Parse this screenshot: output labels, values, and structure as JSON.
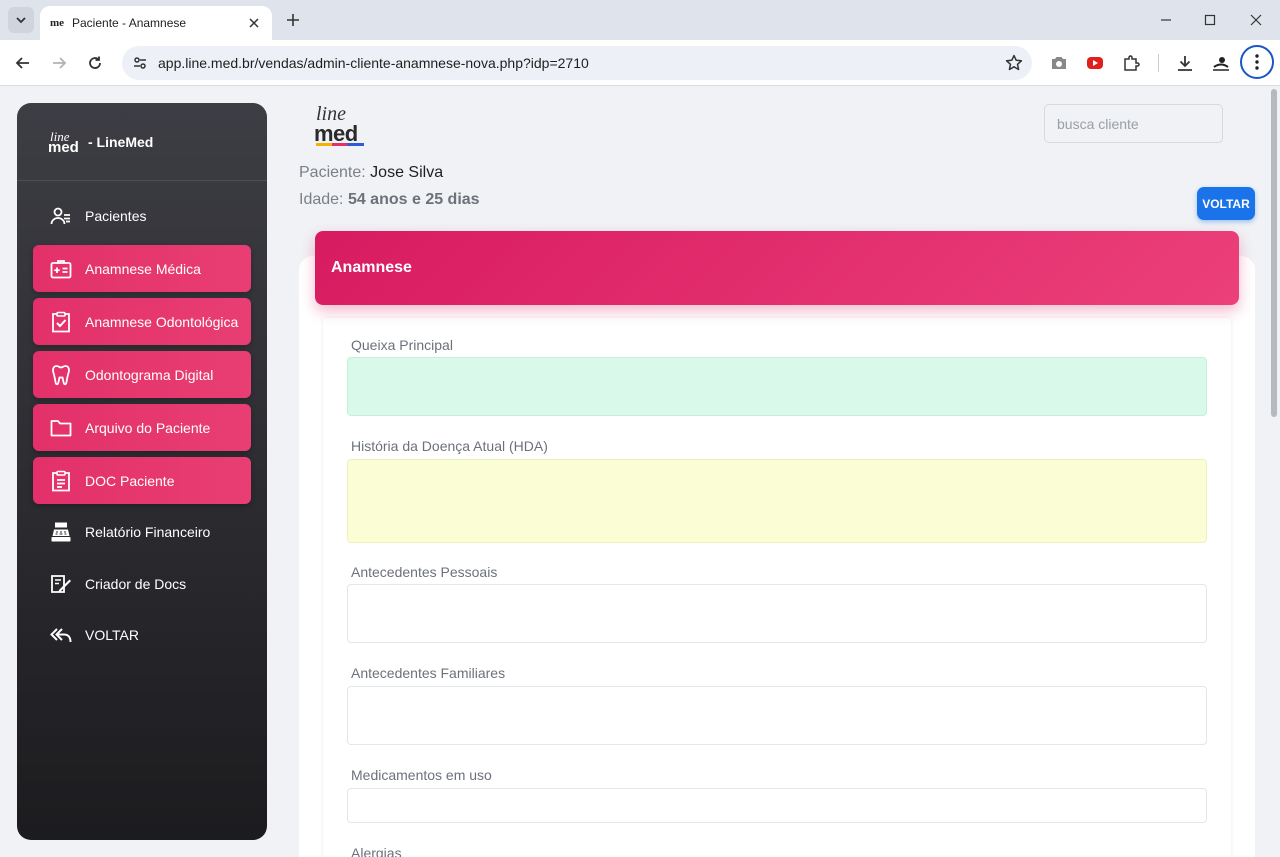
{
  "browser": {
    "tab_title": "Paciente - Anamnese",
    "tab_favicon_text": "me",
    "url": "app.line.med.br/vendas/admin-cliente-anamnese-nova.php?idp=2710"
  },
  "sidebar": {
    "brand_logo_line1": "line",
    "brand_logo_line2": "med",
    "brand_name": "- LineMed",
    "items": [
      {
        "label": "Pacientes",
        "icon": "user-group-icon",
        "active": false
      },
      {
        "label": "Anamnese Médica",
        "icon": "medical-id-icon",
        "active": true
      },
      {
        "label": "Anamnese Odontológica",
        "icon": "clipboard-check-icon",
        "active": true
      },
      {
        "label": "Odontograma Digital",
        "icon": "tooth-icon",
        "active": true
      },
      {
        "label": "Arquivo do Paciente",
        "icon": "folder-icon",
        "active": true
      },
      {
        "label": "DOC Paciente",
        "icon": "document-icon",
        "active": true
      },
      {
        "label": "Relatório Financeiro",
        "icon": "cash-register-icon",
        "active": false
      },
      {
        "label": "Criador de Docs",
        "icon": "doc-creator-icon",
        "active": false
      },
      {
        "label": "VOLTAR",
        "icon": "reply-all-icon",
        "active": false
      }
    ]
  },
  "header": {
    "logo_line1": "line",
    "logo_line2": "med",
    "search_placeholder": "busca cliente",
    "patient_label": "Paciente:",
    "patient_name": "Jose Silva",
    "age_label": "Idade:",
    "age_value": "54 anos e 25 dias",
    "back_button": "VOLTAR"
  },
  "form": {
    "title": "Anamnese",
    "fields": [
      {
        "label": "Queixa Principal",
        "value": ""
      },
      {
        "label": "História da Doença Atual (HDA)",
        "value": ""
      },
      {
        "label": "Antecedentes Pessoais",
        "value": ""
      },
      {
        "label": "Antecedentes Familiares",
        "value": ""
      },
      {
        "label": "Medicamentos em uso",
        "value": ""
      },
      {
        "label": "Alergias",
        "value": ""
      }
    ]
  },
  "colors": {
    "accent_pink": "#e3306a",
    "primary_blue": "#1a73e8",
    "field_green": "#d9f9ea",
    "field_yellow": "#fbfdd5"
  }
}
